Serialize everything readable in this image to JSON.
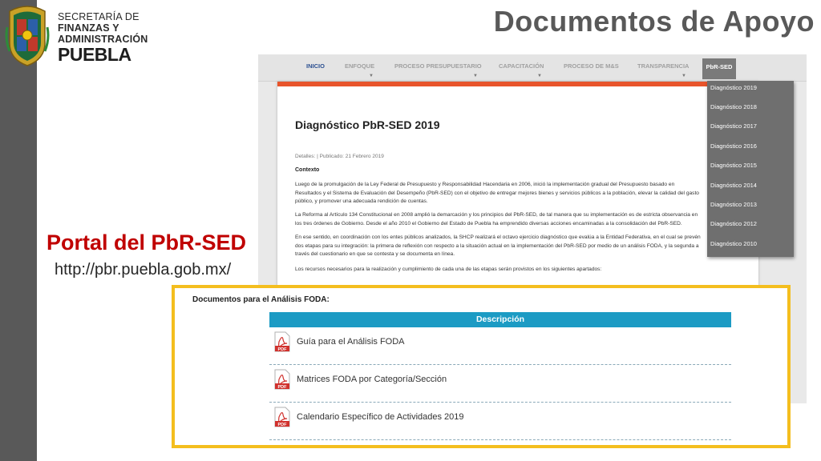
{
  "organization": {
    "line1": "SECRETARÍA DE",
    "line2": "FINANZAS Y",
    "line3": "ADMINISTRACIÓN",
    "state": "PUEBLA",
    "seal_icon": "state-seal-icon"
  },
  "slide": {
    "title": "Documentos de Apoyo",
    "portal_title": "Portal del PbR-SED",
    "portal_url": "http://pbr.puebla.gob.mx/"
  },
  "nav": {
    "items": [
      "INICIO",
      "ENFOQUE",
      "PROCESO PRESUPUESTARIO",
      "CAPACITACIÓN",
      "PROCESO DE M&S",
      "TRANSPARENCIA"
    ],
    "active": "PbR-SED"
  },
  "dropdown": {
    "items": [
      "Diagnóstico 2019",
      "Diagnóstico 2018",
      "Diagnóstico 2017",
      "Diagnóstico 2016",
      "Diagnóstico 2015",
      "Diagnóstico 2014",
      "Diagnóstico 2013",
      "Diagnóstico 2012",
      "Diagnóstico 2010"
    ]
  },
  "article": {
    "title": "Diagnóstico PbR-SED 2019",
    "meta": "Detalles: | Publicado: 21 Febrero 2019",
    "section": "Contexto",
    "paragraphs": [
      [
        "Luego de la promulgación de la Ley Federal de Presupuesto y Responsabilidad Hacendaria en 2006, inició la implementación gradual del Presupuesto basado en",
        "Resultados y el Sistema de Evaluación del Desempeño (PbR-SED) con el objetivo de entregar mejores bienes y servicios públicos a la población, elevar la calidad del gasto",
        "público, y promover una adecuada rendición de cuentas."
      ],
      [
        "La Reforma al Artículo 134 Constitucional en 2008 amplió la demarcación y los principios del PbR-SED, de tal manera que su implementación es de estricta observancia en",
        "los tres órdenes de Gobierno. Desde el año 2010 el Gobierno del Estado de Puebla ha emprendido diversas acciones encaminadas a la consolidación del PbR-SED."
      ],
      [
        "En ese sentido, en coordinación con los entes públicos analizados, la SHCP realizará el octavo ejercicio diagnóstico que evalúa a la Entidad Federativa, en el cual se prevén",
        "dos etapas para su integración: la primera de reflexión con respecto a la situación actual en la implementación del PbR-SED por medio de un análisis FODA, y la segunda a",
        "través del cuestionario en que se contesta y se documenta en línea."
      ],
      [
        "Los recursos necesarios para la realización y cumplimiento de cada una de las etapas serán provistos en los siguientes apartados:"
      ]
    ]
  },
  "documents": {
    "heading": "Documentos para el Análisis FODA:",
    "column_header": "Descripción",
    "pdf_label": "PDF",
    "rows": [
      "Guía para el Análisis FODA",
      "Matrices FODA por Categoría/Sección",
      "Calendario Específico de Actividades 2019"
    ],
    "row_icon": "pdf-file-icon"
  },
  "colors": {
    "accent_red": "#c00000",
    "highlight_border": "#f4be1e",
    "table_header": "#1c9bc4",
    "paper_top": "#e8542b",
    "nav_active": "#2b4f91"
  }
}
